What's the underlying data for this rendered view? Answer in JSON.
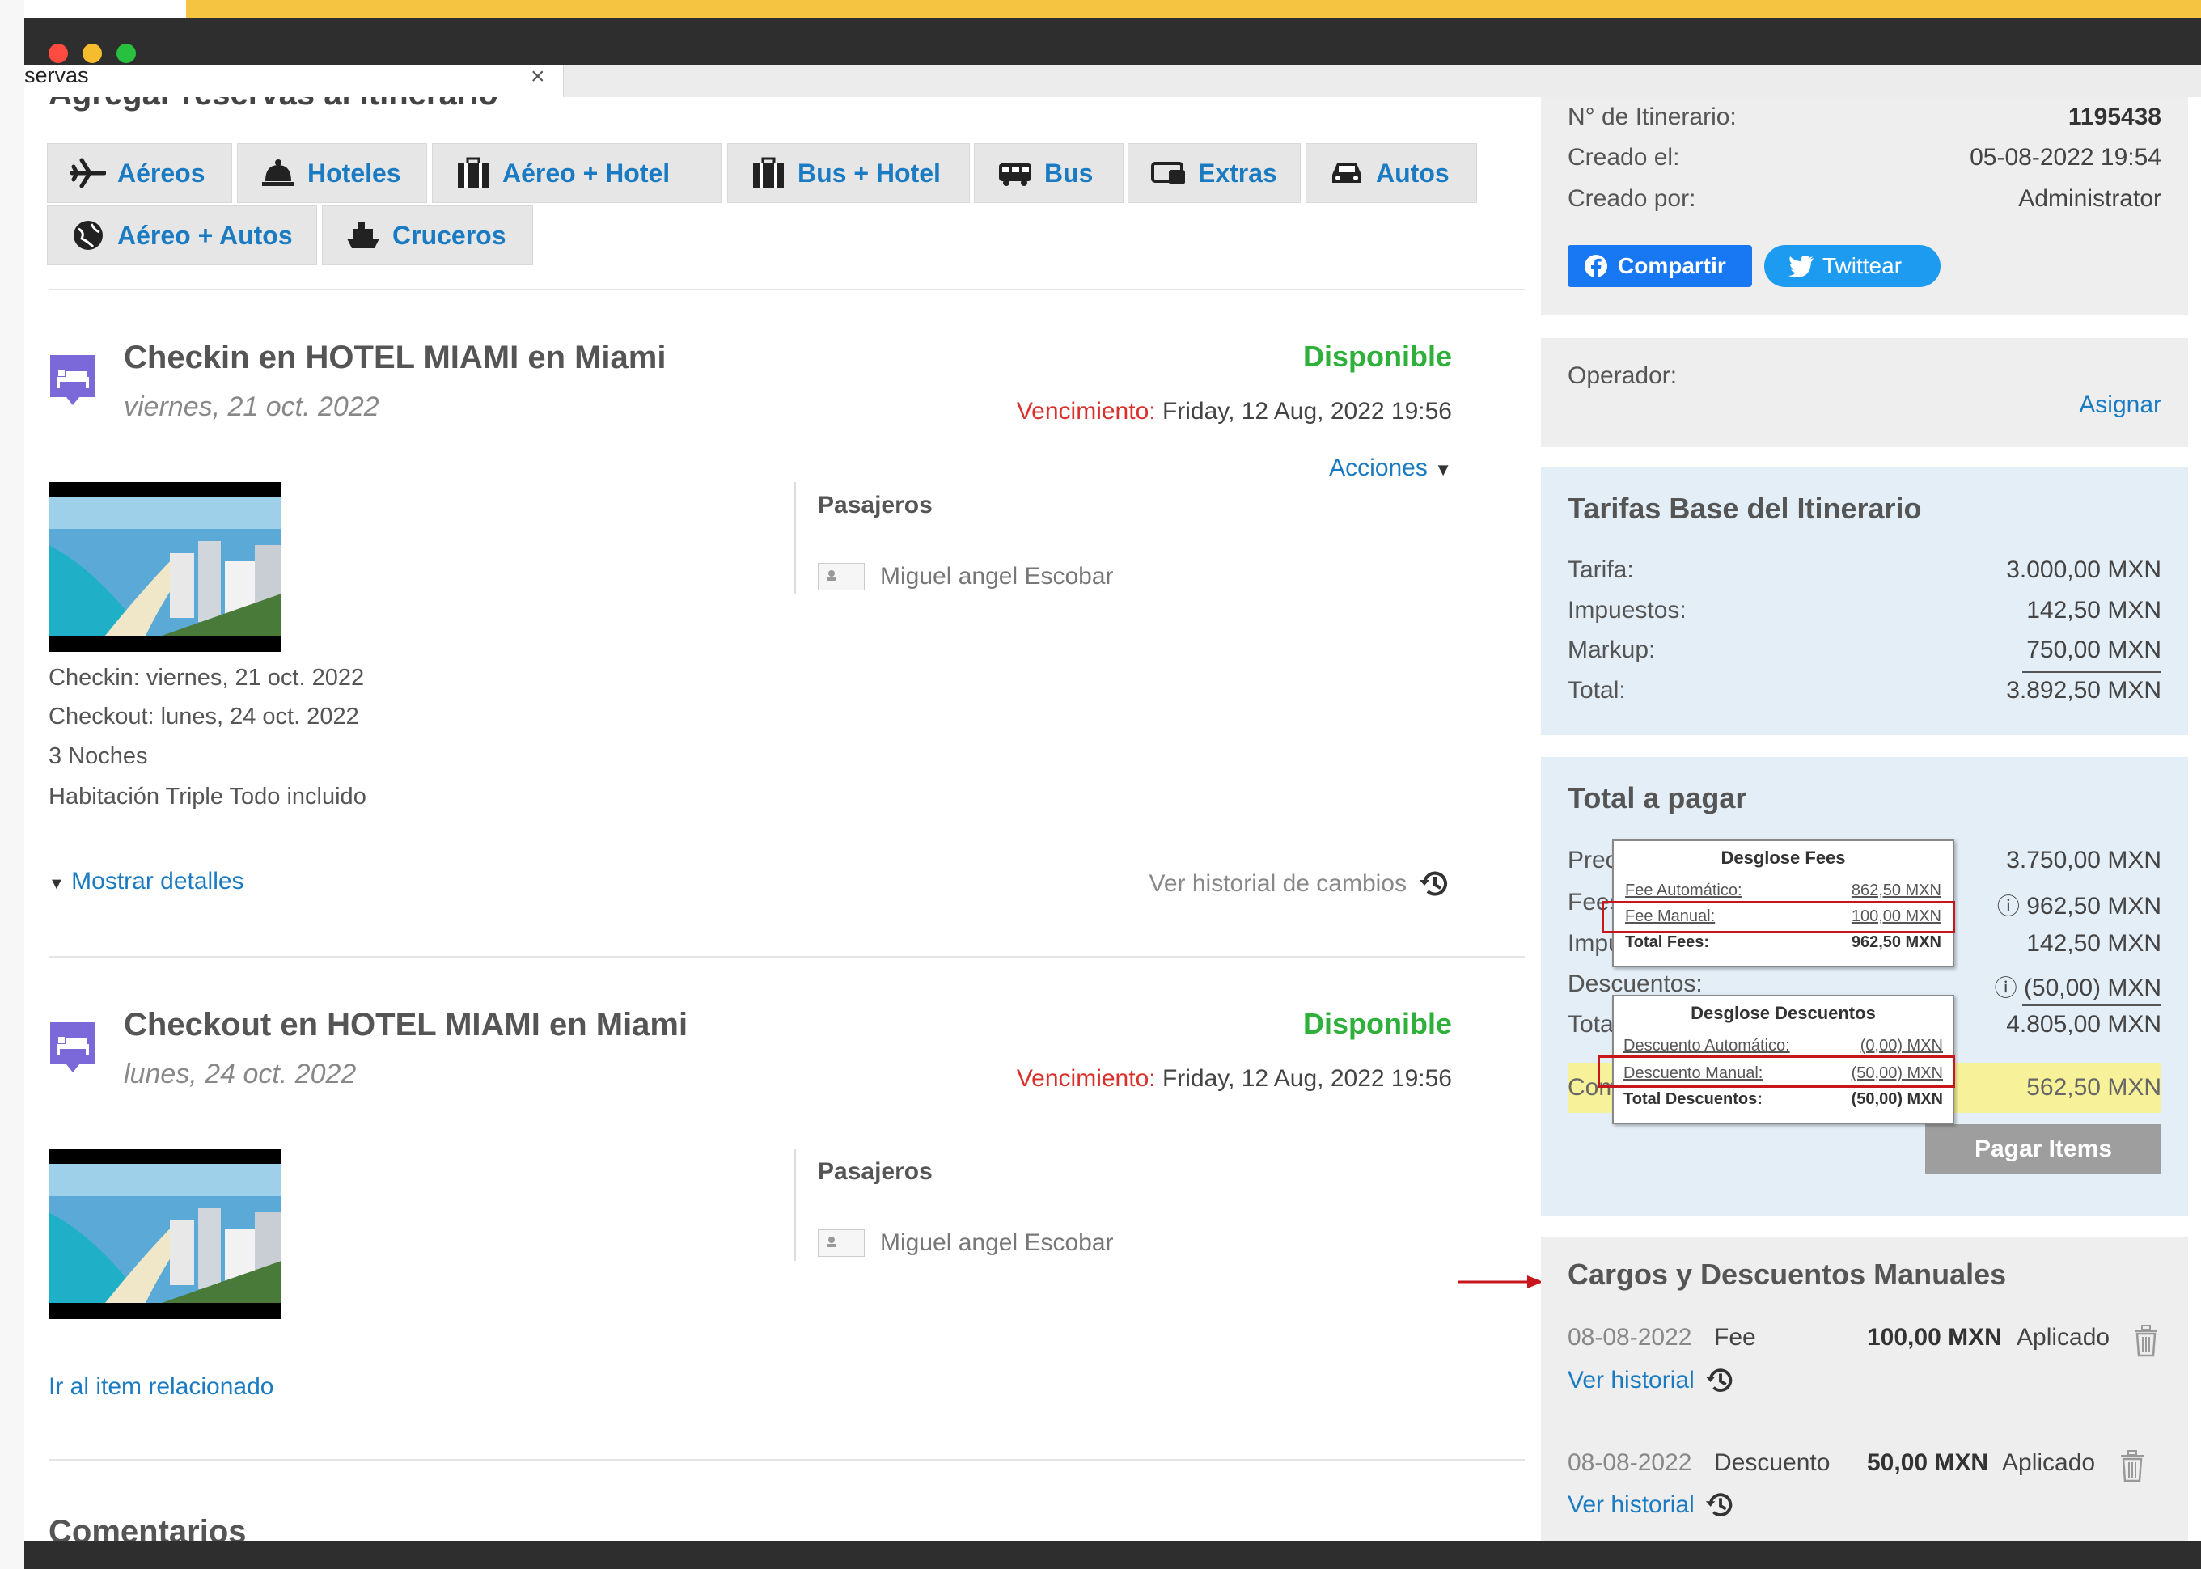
{
  "window": {
    "tab_title": "servas",
    "tab_close": "×"
  },
  "colors": {
    "accent_link": "#1a7bc2",
    "available_green": "#2fb03a",
    "expiry_red": "#d9302b",
    "alert_red": "#c8161d",
    "highlight_yellow": "#f7f29a",
    "panel_blue": "#e3eef7",
    "panel_gray": "#eeeeee"
  },
  "left": {
    "heading": "Agregar reservas al itinerario",
    "services": [
      {
        "label": "Aéreos",
        "icon": "airplane-icon"
      },
      {
        "label": "Hoteles",
        "icon": "bell-icon"
      },
      {
        "label": "Aéreo + Hotel",
        "icon": "luggage-icon"
      },
      {
        "label": "Bus + Hotel",
        "icon": "luggage-icon"
      },
      {
        "label": "Bus",
        "icon": "bus-icon"
      },
      {
        "label": "Extras",
        "icon": "ticket-icon"
      },
      {
        "label": "Autos",
        "icon": "car-icon"
      },
      {
        "label": "Aéreo + Autos",
        "icon": "globe-icon"
      },
      {
        "label": "Cruceros",
        "icon": "ship-icon"
      }
    ],
    "items": [
      {
        "title": "Checkin en HOTEL MIAMI en Miami",
        "date": "viernes, 21 oct. 2022",
        "status": "Disponible",
        "expiry_label": "Vencimiento:",
        "expiry_value": "Friday, 12 Aug, 2022 19:56",
        "actions": "Acciones",
        "passengers_heading": "Pasajeros",
        "passenger": "Miguel angel Escobar",
        "details": [
          "Checkin: viernes, 21 oct. 2022",
          "Checkout: lunes, 24 oct. 2022",
          "3 Noches",
          "Habitación Triple Todo incluido"
        ],
        "show_details": "Mostrar detalles",
        "history": "Ver historial de cambios"
      },
      {
        "title": "Checkout en HOTEL MIAMI en Miami",
        "date": "lunes, 24 oct. 2022",
        "status": "Disponible",
        "expiry_label": "Vencimiento:",
        "expiry_value": "Friday, 12 Aug, 2022 19:56",
        "passengers_heading": "Pasajeros",
        "passenger": "Miguel angel Escobar",
        "related_link": "Ir al item relacionado"
      }
    ],
    "comments_heading": "Comentarios"
  },
  "right": {
    "info": {
      "itinerary_label": "N° de Itinerario:",
      "itinerary_value": "1195438",
      "created_label": "Creado el:",
      "created_value": "05-08-2022 19:54",
      "created_by_label": "Creado por:",
      "created_by_value": "Administrator",
      "share_label": "Compartir",
      "tweet_label": "Twittear"
    },
    "operator": {
      "label": "Operador:",
      "assign": "Asignar"
    },
    "base_rates": {
      "title": "Tarifas Base del Itinerario",
      "rows": [
        {
          "label": "Tarifa:",
          "value": "3.000,00 MXN"
        },
        {
          "label": "Impuestos:",
          "value": "142,50 MXN"
        },
        {
          "label": "Markup:",
          "value": "750,00 MXN"
        },
        {
          "label": "Total:",
          "value": "3.892,50 MXN"
        }
      ]
    },
    "total": {
      "title": "Total a pagar",
      "rows": [
        {
          "label": "Precio",
          "value": "3.750,00 MXN"
        },
        {
          "label": "Fees:",
          "value": "962,50 MXN"
        },
        {
          "label": "Impuestos",
          "value": "142,50 MXN"
        },
        {
          "label": "Descuentos:",
          "value": "(50,00) MXN"
        },
        {
          "label": "Total",
          "value": "4.805,00 MXN"
        },
        {
          "label": "Comisión",
          "value": "562,50 MXN"
        }
      ],
      "pay_button": "Pagar Items",
      "fees_tooltip": {
        "title": "Desglose Fees",
        "rows": [
          {
            "label": "Fee Automático:",
            "value": "862,50 MXN"
          },
          {
            "label": "Fee Manual:",
            "value": "100,00 MXN"
          },
          {
            "label": "Total Fees:",
            "value": "962,50 MXN"
          }
        ]
      },
      "discount_tooltip": {
        "title": "Desglose Descuentos",
        "rows": [
          {
            "label": "Descuento Automático:",
            "value": "(0,00) MXN"
          },
          {
            "label": "Descuento Manual:",
            "value": "(50,00) MXN"
          },
          {
            "label": "Total Descuentos:",
            "value": "(50,00) MXN"
          }
        ]
      }
    },
    "manual": {
      "title": "Cargos y Descuentos Manuales",
      "entries": [
        {
          "date": "08-08-2022",
          "type": "Fee",
          "amount": "100,00 MXN",
          "status": "Aplicado",
          "history": "Ver historial"
        },
        {
          "date": "08-08-2022",
          "type": "Descuento",
          "amount": "50,00 MXN",
          "status": "Aplicado",
          "history": "Ver historial"
        }
      ]
    }
  }
}
